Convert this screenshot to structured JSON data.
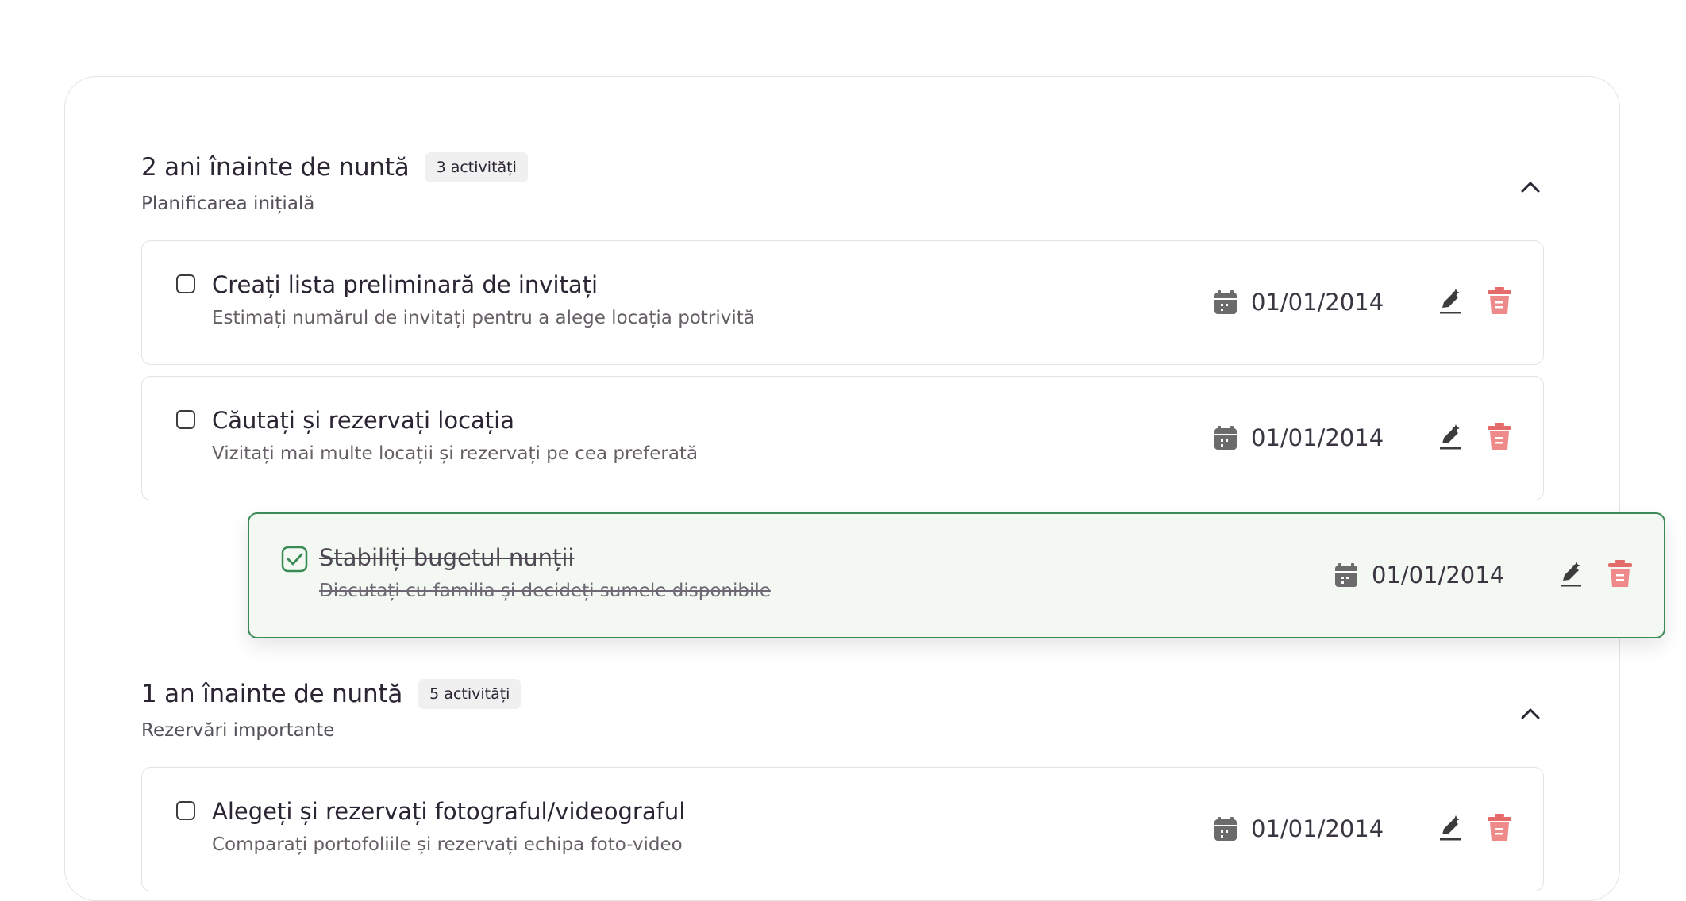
{
  "groups": [
    {
      "title": "2 ani înainte de nuntă",
      "count": "3 activități",
      "subtitle": "Planificarea inițială",
      "tasks": [
        {
          "title": "Creați lista preliminară de invitați",
          "description": "Estimați numărul de invitați pentru a alege locația potrivită",
          "date": "01/01/2014",
          "checked": false
        },
        {
          "title": "Căutați și rezervați locația",
          "description": "Vizitați mai multe locații și rezervați pe cea preferată",
          "date": "01/01/2014",
          "checked": false
        }
      ]
    },
    {
      "title": "1 an înainte de nuntă",
      "count": "5 activități",
      "subtitle": "Rezervări importante",
      "tasks": [
        {
          "title": "Alegeți și rezervați fotograful/videograful",
          "description": "Comparați portofoliile și rezervați echipa foto-video",
          "date": "01/01/2014",
          "checked": false
        }
      ]
    }
  ],
  "dragging_task": {
    "title": "Stabiliți bugetul nunții",
    "description": "Discutați cu familia și decideți sumele disponibile",
    "date": "01/01/2014",
    "checked": true
  },
  "colors": {
    "accent_green": "#3a8a55",
    "delete_red": "#e56b6b",
    "drag_background": "#f3f8f3"
  },
  "icons": {
    "calendar": "calendar-icon",
    "edit": "edit-sparkle-icon",
    "delete": "trash-icon",
    "collapse": "chevron-up-icon",
    "checkbox_checked": "check-square-icon"
  }
}
